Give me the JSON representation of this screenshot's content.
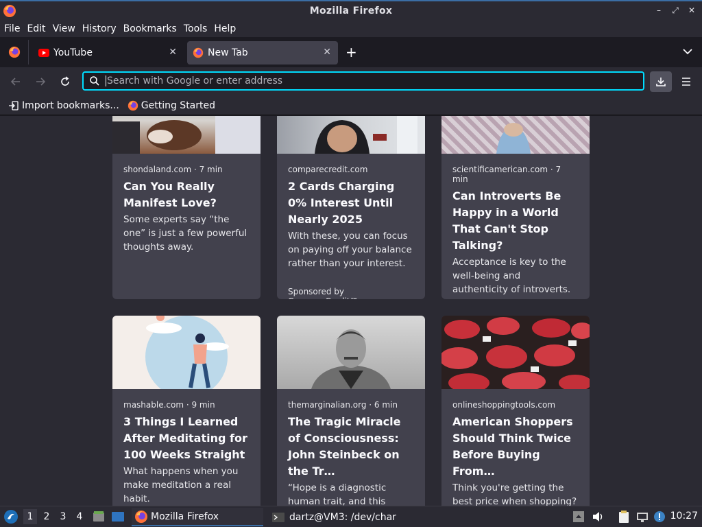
{
  "window": {
    "title": "Mozilla Firefox",
    "controls": {
      "minimize": "–",
      "restore": "⤢",
      "close": "✕"
    }
  },
  "menubar": {
    "items": [
      {
        "label": "File"
      },
      {
        "label": "Edit"
      },
      {
        "label": "View"
      },
      {
        "label": "History"
      },
      {
        "label": "Bookmarks"
      },
      {
        "label": "Tools"
      },
      {
        "label": "Help"
      }
    ]
  },
  "tabs": {
    "items": [
      {
        "label": "YouTube",
        "active": false
      },
      {
        "label": "New Tab",
        "active": true
      }
    ],
    "close_glyph": "✕",
    "new_tab_glyph": "+"
  },
  "navbar": {
    "url_value": "",
    "url_placeholder": "Search with Google or enter address"
  },
  "bookmarks": {
    "items": [
      {
        "label": "Import bookmarks..."
      },
      {
        "label": "Getting Started"
      }
    ]
  },
  "stories": [
    {
      "source": "shondaland.com · 7 min",
      "headline": "Can You Really Manifest Love?",
      "excerpt": "Some experts say “the one” is just a few powerful thoughts away.",
      "sponsor": ""
    },
    {
      "source": "comparecredit.com",
      "headline": "2 Cards Charging 0% Interest Until Nearly 2025",
      "excerpt": "With these, you can focus on paying off your balance rather than your interest.",
      "sponsor": "Sponsored by CompareCredit™"
    },
    {
      "source": "scientificamerican.com · 7 min",
      "headline": "Can Introverts Be Happy in a World That Can't Stop Talking?",
      "excerpt": "Acceptance is key to the well-being and authenticity of introverts.",
      "sponsor": ""
    },
    {
      "source": "mashable.com · 9 min",
      "headline": "3 Things I Learned After Meditating for 100 Weeks Straight",
      "excerpt": "What happens when you make meditation a real habit.",
      "sponsor": ""
    },
    {
      "source": "themarginalian.org · 6 min",
      "headline": "The Tragic Miracle of Consciousness: John Steinbeck on the Tr…",
      "excerpt": "“Hope is a diagnostic human trait, and this simple cortex symptom seems to be a…",
      "sponsor": ""
    },
    {
      "source": "onlineshoppingtools.com",
      "headline": "American Shoppers Should Think Twice Before Buying From…",
      "excerpt": "Think you're getting the best price when shopping? Think again.",
      "sponsor": ""
    }
  ],
  "taskbar": {
    "workspaces": [
      "1",
      "2",
      "3",
      "4"
    ],
    "active_workspace": "1",
    "tasks": [
      {
        "label": "Mozilla Firefox",
        "active": true
      },
      {
        "label": "dartz@VM3: /dev/char",
        "active": false
      }
    ],
    "clock": "10:27"
  },
  "colors": {
    "accent": "#00ddff",
    "tab_active": "#42414d",
    "card_bg": "#42414d",
    "page_bg": "#2b2a33"
  }
}
